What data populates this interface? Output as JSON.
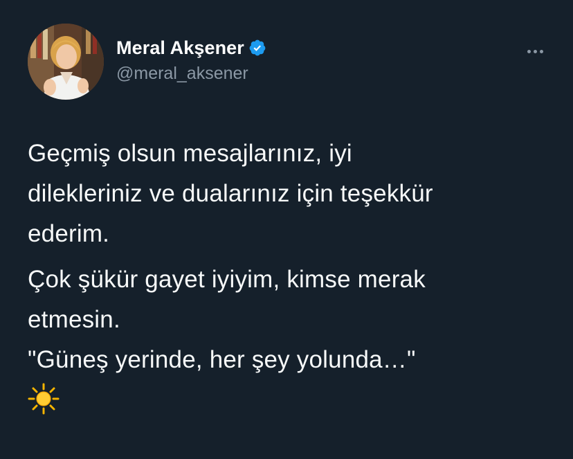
{
  "tweet": {
    "author": {
      "display_name": "Meral Akşener",
      "handle": "@meral_aksener",
      "verified": true,
      "avatar_icon": "profile-photo"
    },
    "more_icon": "more-horizontal-icon",
    "paragraphs": [
      "Geçmiş olsun mesajlarınız, iyi\ndilekleriniz ve dualarınız için teşekkür\nederim.",
      "Çok şükür gayet iyiyim, kimse merak\netmesin.\n\"Güneş yerinde, her şey yolunda…\""
    ],
    "emoji": "sun-emoji"
  },
  "colors": {
    "background": "#15202b",
    "text_primary": "#f7f9f9",
    "text_secondary": "#8b98a5",
    "verified_badge": "#1d9bf0"
  }
}
